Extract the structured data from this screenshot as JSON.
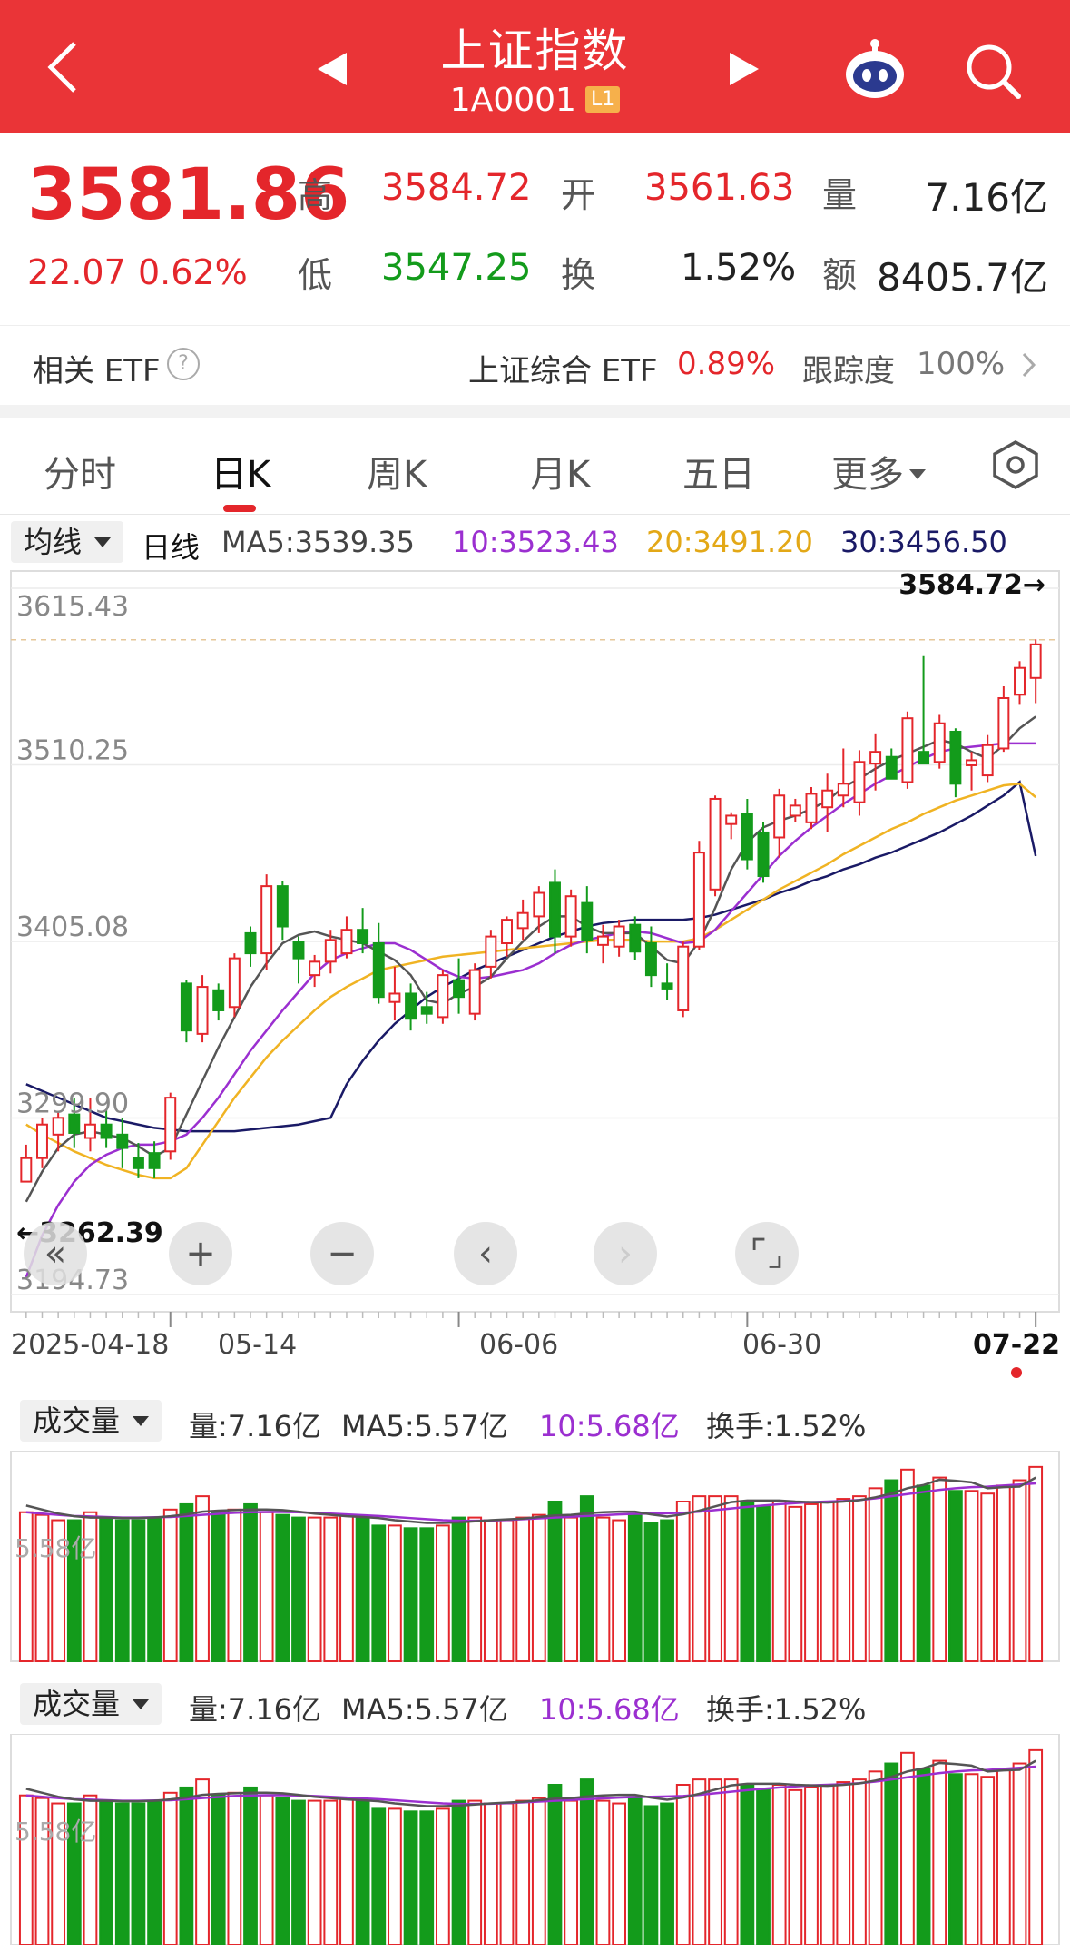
{
  "header": {
    "title": "上证指数",
    "code": "1A0001",
    "level_badge": "L1",
    "icons": [
      "back-arrow-icon",
      "prev-triangle-icon",
      "next-triangle-icon",
      "robot-assistant-icon",
      "search-icon"
    ]
  },
  "quote": {
    "price": "3581.86",
    "change": "22.07",
    "change_pct": "0.62%",
    "high_label": "高",
    "high": "3584.72",
    "low_label": "低",
    "low": "3547.25",
    "open_label": "开",
    "open": "3561.63",
    "turnover_label": "换",
    "turnover": "1.52%",
    "volume_label": "量",
    "volume": "7.16亿",
    "amount_label": "额",
    "amount": "8405.7亿"
  },
  "etf": {
    "label": "相关 ETF",
    "help_icon": "?",
    "name": "上证综合 ETF",
    "pct": "0.89%",
    "track_label": "跟踪度",
    "track_value": "100%"
  },
  "tabs": [
    "分时",
    "日K",
    "周K",
    "月K",
    "五日",
    "更多"
  ],
  "active_tab": 1,
  "ma": {
    "chip": "均线",
    "kind": "日线",
    "ma5": "MA5:3539.35",
    "ma10": "10:3523.43",
    "ma20": "20:3491.20",
    "ma30": "30:3456.50"
  },
  "colors": {
    "up": "#e4262b",
    "down": "#139b1b",
    "ma5": "#555555",
    "ma10": "#9b2fd0",
    "ma20": "#f0b323",
    "ma30": "#1a1a66"
  },
  "chart_data": {
    "type": "candlestick",
    "y_ticks": [
      "3615.43",
      "3510.25",
      "3405.08",
      "3299.90",
      "3194.73"
    ],
    "ylim": [
      3194.73,
      3615.43
    ],
    "x_labels": [
      "2025-04-18",
      "05-14",
      "06-06",
      "06-30",
      "07-22"
    ],
    "max_label": "3584.72→",
    "min_label": "←3262.39",
    "candles": [
      {
        "o": 3262,
        "h": 3284,
        "l": 3262,
        "c": 3276
      },
      {
        "o": 3276,
        "h": 3300,
        "l": 3270,
        "c": 3296
      },
      {
        "o": 3290,
        "h": 3304,
        "l": 3280,
        "c": 3300
      },
      {
        "o": 3302,
        "h": 3312,
        "l": 3282,
        "c": 3291
      },
      {
        "o": 3288,
        "h": 3312,
        "l": 3280,
        "c": 3296
      },
      {
        "o": 3296,
        "h": 3305,
        "l": 3282,
        "c": 3288
      },
      {
        "o": 3290,
        "h": 3300,
        "l": 3270,
        "c": 3282
      },
      {
        "o": 3276,
        "h": 3285,
        "l": 3264,
        "c": 3270
      },
      {
        "o": 3279,
        "h": 3286,
        "l": 3264,
        "c": 3270
      },
      {
        "o": 3280,
        "h": 3315,
        "l": 3275,
        "c": 3312
      },
      {
        "o": 3380,
        "h": 3382,
        "l": 3345,
        "c": 3352
      },
      {
        "o": 3350,
        "h": 3385,
        "l": 3345,
        "c": 3378
      },
      {
        "o": 3376,
        "h": 3380,
        "l": 3358,
        "c": 3364
      },
      {
        "o": 3366,
        "h": 3398,
        "l": 3360,
        "c": 3395
      },
      {
        "o": 3410,
        "h": 3414,
        "l": 3390,
        "c": 3398
      },
      {
        "o": 3398,
        "h": 3445,
        "l": 3388,
        "c": 3438
      },
      {
        "o": 3438,
        "h": 3441,
        "l": 3406,
        "c": 3414
      },
      {
        "o": 3405,
        "h": 3408,
        "l": 3380,
        "c": 3395
      },
      {
        "o": 3385,
        "h": 3397,
        "l": 3378,
        "c": 3393
      },
      {
        "o": 3393,
        "h": 3412,
        "l": 3386,
        "c": 3406
      },
      {
        "o": 3398,
        "h": 3420,
        "l": 3395,
        "c": 3412
      },
      {
        "o": 3412,
        "h": 3425,
        "l": 3398,
        "c": 3404
      },
      {
        "o": 3404,
        "h": 3416,
        "l": 3368,
        "c": 3372
      },
      {
        "o": 3369,
        "h": 3390,
        "l": 3358,
        "c": 3374
      },
      {
        "o": 3374,
        "h": 3380,
        "l": 3352,
        "c": 3359
      },
      {
        "o": 3366,
        "h": 3375,
        "l": 3356,
        "c": 3362
      },
      {
        "o": 3360,
        "h": 3388,
        "l": 3356,
        "c": 3385
      },
      {
        "o": 3382,
        "h": 3395,
        "l": 3362,
        "c": 3372
      },
      {
        "o": 3362,
        "h": 3392,
        "l": 3358,
        "c": 3388
      },
      {
        "o": 3390,
        "h": 3412,
        "l": 3383,
        "c": 3408
      },
      {
        "o": 3404,
        "h": 3420,
        "l": 3396,
        "c": 3418
      },
      {
        "o": 3413,
        "h": 3430,
        "l": 3406,
        "c": 3422
      },
      {
        "o": 3420,
        "h": 3438,
        "l": 3410,
        "c": 3434
      },
      {
        "o": 3440,
        "h": 3448,
        "l": 3398,
        "c": 3408
      },
      {
        "o": 3408,
        "h": 3436,
        "l": 3402,
        "c": 3432
      },
      {
        "o": 3428,
        "h": 3438,
        "l": 3398,
        "c": 3406
      },
      {
        "o": 3403,
        "h": 3415,
        "l": 3392,
        "c": 3408
      },
      {
        "o": 3402,
        "h": 3418,
        "l": 3396,
        "c": 3414
      },
      {
        "o": 3415,
        "h": 3420,
        "l": 3394,
        "c": 3399
      },
      {
        "o": 3404,
        "h": 3414,
        "l": 3378,
        "c": 3385
      },
      {
        "o": 3380,
        "h": 3392,
        "l": 3370,
        "c": 3377
      },
      {
        "o": 3364,
        "h": 3405,
        "l": 3360,
        "c": 3402
      },
      {
        "o": 3402,
        "h": 3465,
        "l": 3400,
        "c": 3458
      },
      {
        "o": 3436,
        "h": 3492,
        "l": 3432,
        "c": 3490
      },
      {
        "o": 3475,
        "h": 3482,
        "l": 3466,
        "c": 3480
      },
      {
        "o": 3481,
        "h": 3490,
        "l": 3448,
        "c": 3454
      },
      {
        "o": 3470,
        "h": 3476,
        "l": 3440,
        "c": 3444
      },
      {
        "o": 3467,
        "h": 3496,
        "l": 3455,
        "c": 3492
      },
      {
        "o": 3480,
        "h": 3490,
        "l": 3476,
        "c": 3486
      },
      {
        "o": 3476,
        "h": 3497,
        "l": 3472,
        "c": 3493
      },
      {
        "o": 3485,
        "h": 3505,
        "l": 3470,
        "c": 3495
      },
      {
        "o": 3492,
        "h": 3520,
        "l": 3485,
        "c": 3499
      },
      {
        "o": 3488,
        "h": 3519,
        "l": 3480,
        "c": 3512
      },
      {
        "o": 3511,
        "h": 3529,
        "l": 3495,
        "c": 3518
      },
      {
        "o": 3515,
        "h": 3520,
        "l": 3505,
        "c": 3502
      },
      {
        "o": 3500,
        "h": 3542,
        "l": 3496,
        "c": 3538
      },
      {
        "o": 3518,
        "h": 3575,
        "l": 3512,
        "c": 3511
      },
      {
        "o": 3512,
        "h": 3540,
        "l": 3508,
        "c": 3535
      },
      {
        "o": 3530,
        "h": 3532,
        "l": 3491,
        "c": 3499
      },
      {
        "o": 3510,
        "h": 3518,
        "l": 3495,
        "c": 3513
      },
      {
        "o": 3504,
        "h": 3528,
        "l": 3500,
        "c": 3522
      },
      {
        "o": 3520,
        "h": 3557,
        "l": 3518,
        "c": 3550
      },
      {
        "o": 3552,
        "h": 3572,
        "l": 3546,
        "c": 3568
      },
      {
        "o": 3562,
        "h": 3585,
        "l": 3547,
        "c": 3582
      }
    ],
    "ma5": [
      3250,
      3268,
      3282,
      3290,
      3292,
      3290,
      3288,
      3283,
      3277,
      3282,
      3302,
      3322,
      3342,
      3360,
      3378,
      3392,
      3404,
      3409,
      3411,
      3408,
      3406,
      3404,
      3399,
      3394,
      3385,
      3370,
      3368,
      3374,
      3378,
      3384,
      3395,
      3405,
      3414,
      3420,
      3420,
      3414,
      3410,
      3410,
      3410,
      3402,
      3394,
      3392,
      3405,
      3425,
      3448,
      3464,
      3473,
      3477,
      3480,
      3484,
      3489,
      3497,
      3502,
      3508,
      3513,
      3517,
      3521,
      3525,
      3523,
      3518,
      3514,
      3522,
      3532,
      3539
    ],
    "ma10": [
      3205,
      3230,
      3248,
      3262,
      3272,
      3278,
      3282,
      3284,
      3284,
      3286,
      3290,
      3300,
      3312,
      3326,
      3340,
      3352,
      3364,
      3375,
      3386,
      3394,
      3398,
      3401,
      3404,
      3404,
      3400,
      3394,
      3388,
      3384,
      3383,
      3384,
      3386,
      3388,
      3392,
      3398,
      3403,
      3406,
      3408,
      3410,
      3411,
      3410,
      3407,
      3404,
      3405,
      3412,
      3423,
      3434,
      3445,
      3456,
      3465,
      3473,
      3480,
      3487,
      3493,
      3499,
      3504,
      3509,
      3514,
      3518,
      3520,
      3521,
      3522,
      3523,
      3523,
      3523
    ],
    "ma20": [
      3296,
      3290,
      3285,
      3280,
      3276,
      3272,
      3269,
      3266,
      3264,
      3264,
      3270,
      3284,
      3298,
      3312,
      3324,
      3336,
      3346,
      3355,
      3364,
      3372,
      3378,
      3383,
      3388,
      3390,
      3392,
      3394,
      3396,
      3397,
      3398,
      3399,
      3400,
      3401,
      3402,
      3403,
      3404,
      3405,
      3406,
      3406,
      3406,
      3405,
      3405,
      3405,
      3407,
      3412,
      3418,
      3424,
      3430,
      3436,
      3441,
      3446,
      3451,
      3457,
      3462,
      3467,
      3472,
      3476,
      3481,
      3485,
      3489,
      3492,
      3495,
      3498,
      3499,
      3491
    ],
    "ma30": [
      3320,
      3316,
      3312,
      3308,
      3304,
      3300,
      3298,
      3296,
      3294,
      3293,
      3292,
      3292,
      3292,
      3292,
      3293,
      3294,
      3295,
      3296,
      3298,
      3300,
      3320,
      3334,
      3346,
      3356,
      3364,
      3372,
      3378,
      3383,
      3388,
      3392,
      3396,
      3400,
      3404,
      3408,
      3411,
      3414,
      3416,
      3417,
      3418,
      3418,
      3418,
      3418,
      3419,
      3421,
      3424,
      3427,
      3430,
      3434,
      3437,
      3441,
      3444,
      3448,
      3451,
      3455,
      3458,
      3462,
      3466,
      3470,
      3475,
      3480,
      3486,
      3492,
      3500,
      3456
    ]
  },
  "volume_panels": [
    {
      "chip": "成交量",
      "vol": "量:7.16亿",
      "ma5": "MA5:5.57亿",
      "ma10": "10:5.68亿",
      "turnover": "换手:1.52%",
      "side_label": "5.58亿"
    },
    {
      "chip": "成交量",
      "vol": "量:7.16亿",
      "ma5": "MA5:5.57亿",
      "ma10": "10:5.68亿",
      "turnover": "换手:1.52%",
      "side_label": "5.58亿"
    }
  ],
  "volume_data": {
    "values": [
      5.6,
      5.5,
      5.3,
      5.3,
      5.6,
      5.4,
      5.3,
      5.3,
      5.4,
      5.7,
      5.9,
      6.2,
      5.6,
      5.7,
      5.9,
      5.6,
      5.5,
      5.4,
      5.4,
      5.4,
      5.5,
      5.4,
      5.1,
      5.1,
      5.0,
      5.0,
      5.1,
      5.4,
      5.4,
      5.3,
      5.3,
      5.4,
      5.5,
      6.0,
      5.4,
      6.2,
      5.4,
      5.3,
      5.5,
      5.2,
      5.3,
      6.0,
      6.2,
      6.2,
      6.2,
      6.0,
      5.8,
      6.0,
      5.8,
      5.9,
      6.0,
      6.1,
      6.2,
      6.5,
      6.8,
      7.2,
      6.6,
      6.9,
      6.4,
      6.4,
      6.3,
      6.6,
      6.8,
      7.3
    ],
    "ma5": [
      5.85,
      5.7,
      5.55,
      5.45,
      5.4,
      5.4,
      5.38,
      5.38,
      5.4,
      5.45,
      5.52,
      5.62,
      5.66,
      5.68,
      5.7,
      5.7,
      5.68,
      5.62,
      5.55,
      5.5,
      5.45,
      5.42,
      5.38,
      5.3,
      5.25,
      5.2,
      5.2,
      5.22,
      5.26,
      5.3,
      5.33,
      5.36,
      5.42,
      5.48,
      5.5,
      5.56,
      5.6,
      5.62,
      5.62,
      5.52,
      5.44,
      5.52,
      5.66,
      5.82,
      5.98,
      6.04,
      6.04,
      6.04,
      6.0,
      5.98,
      5.96,
      6.0,
      6.05,
      6.16,
      6.3,
      6.5,
      6.62,
      6.82,
      6.78,
      6.72,
      6.5,
      6.54,
      6.56,
      6.9
    ],
    "ma10": [
      5.6,
      5.55,
      5.5,
      5.46,
      5.44,
      5.42,
      5.4,
      5.4,
      5.41,
      5.42,
      5.46,
      5.5,
      5.54,
      5.58,
      5.6,
      5.61,
      5.61,
      5.6,
      5.58,
      5.55,
      5.52,
      5.49,
      5.46,
      5.42,
      5.38,
      5.34,
      5.3,
      5.28,
      5.28,
      5.29,
      5.31,
      5.34,
      5.37,
      5.4,
      5.43,
      5.46,
      5.49,
      5.52,
      5.54,
      5.55,
      5.56,
      5.58,
      5.62,
      5.68,
      5.74,
      5.8,
      5.85,
      5.9,
      5.94,
      5.98,
      6.0,
      6.02,
      6.06,
      6.12,
      6.2,
      6.28,
      6.36,
      6.44,
      6.5,
      6.54,
      6.56,
      6.6,
      6.64,
      6.68
    ],
    "ymax": 7.5
  }
}
